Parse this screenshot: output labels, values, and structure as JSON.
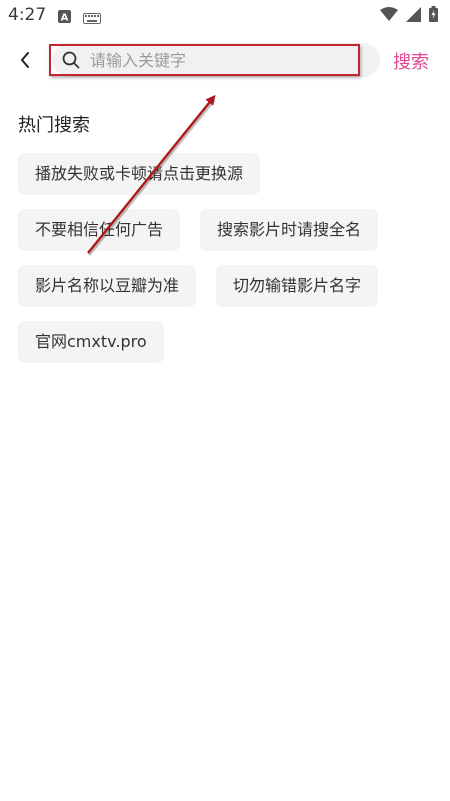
{
  "status": {
    "time": "4:27",
    "icons": [
      "notification-a-icon",
      "keyboard-icon",
      "wifi-icon",
      "signal-icon",
      "battery-icon"
    ]
  },
  "header": {
    "back_icon": "chevron-left-icon",
    "search_placeholder": "请输入关键字",
    "search_icon": "search-icon",
    "search_action": "搜索"
  },
  "hot": {
    "title": "热门搜索",
    "tags": [
      "播放失败或卡顿请点击更换源",
      "不要相信任何广告",
      "搜索影片时请搜全名",
      "影片名称以豆瓣为准",
      "切勿输错影片名字",
      "官网cmxtv.pro"
    ]
  },
  "colors": {
    "accent": "#e3478e",
    "annotation": "#c0282d",
    "tag_bg": "#f4f4f4",
    "search_bg": "#f1f1f3"
  }
}
